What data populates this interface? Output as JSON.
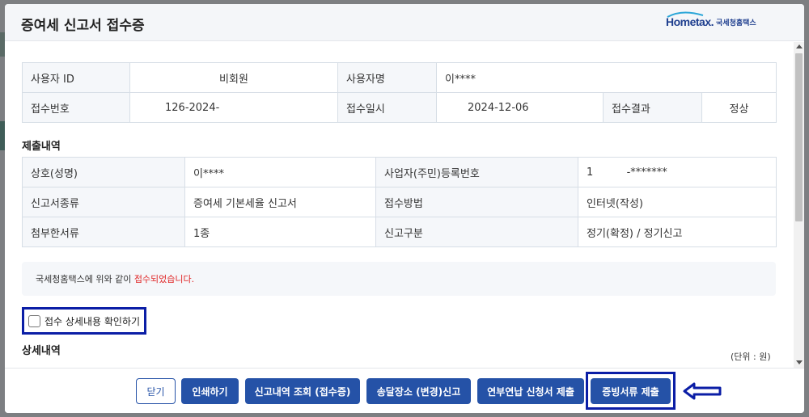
{
  "modal": {
    "title": "증여세 신고서 접수증",
    "logo_main": "Hometax.",
    "logo_sub": "국세청홈택스"
  },
  "info_table": {
    "user_id_label": "사용자 ID",
    "user_id_value": "비회원",
    "user_name_label": "사용자명",
    "user_name_value": "이****",
    "receipt_no_label": "접수번호",
    "receipt_no_value": "126-2024-",
    "receipt_date_label": "접수일시",
    "receipt_date_value": "2024-12-06",
    "receipt_result_label": "접수결과",
    "receipt_result_value": "정상"
  },
  "submission": {
    "section_title": "제출내역",
    "rows": [
      {
        "label1": "상호(성명)",
        "value1": "이****",
        "label2": "사업자(주민)등록번호",
        "value2": "1          -*******"
      },
      {
        "label1": "신고서종류",
        "value1": "증여세 기본세율 신고서",
        "label2": "접수방법",
        "value2": "인터넷(작성)"
      },
      {
        "label1": "첨부한서류",
        "value1": "1종",
        "label2": "신고구분",
        "value2": "정기(확정) / 정기신고"
      }
    ]
  },
  "notice": {
    "prefix": "국세청홈택스에 위와 같이 ",
    "highlight": "접수되었습니다."
  },
  "checkbox": {
    "label": "접수 상세내용 확인하기"
  },
  "detail": {
    "section_title": "상세내역",
    "unit": "(단위 : 원)"
  },
  "footer": {
    "close": "닫기",
    "print": "인쇄하기",
    "history": "신고내역 조회 (접수증)",
    "address": "송달장소 (변경)신고",
    "installment": "연부연납 신청서 제출",
    "evidence": "증빙서류 제출"
  },
  "colors": {
    "primary": "#2552a7",
    "highlight_border": "#0b1ea6",
    "notice_red": "#e02424"
  }
}
